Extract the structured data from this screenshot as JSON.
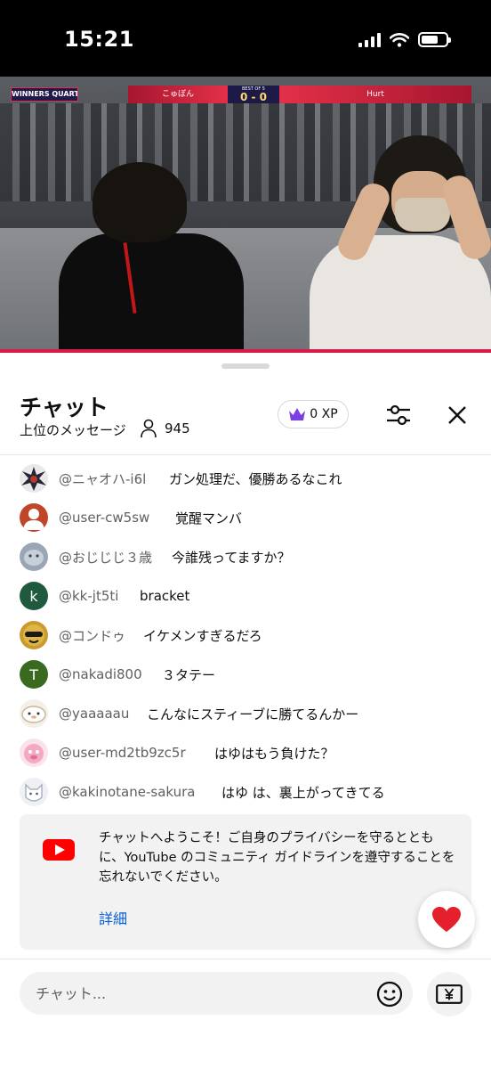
{
  "status_bar": {
    "time": "15:21"
  },
  "video": {
    "round_label": "WINNERS QUARTERS",
    "player_left": "こゅぼん",
    "best_of": "BEST OF 5",
    "score": "0 - 0",
    "player_right": "Hurt"
  },
  "chat_header": {
    "title": "チャット",
    "subtitle": "上位のメッセージ",
    "viewer_count": "945",
    "xp_label": "0 XP"
  },
  "messages": [
    {
      "author": "@ニャオハ-i6l",
      "text": "ガン処理だ、優勝あるなこれ",
      "avatar_letter": "",
      "avatar_color": "#e9e9e9"
    },
    {
      "author": "@user-cw5sw",
      "text": "覚醒マンバ",
      "avatar_letter": "",
      "avatar_color": "#c0462a"
    },
    {
      "author": "@おじじじ３歳",
      "text": "今誰残ってますか？",
      "avatar_letter": "",
      "avatar_color": "#9aa6b4"
    },
    {
      "author": "@kk-jt5ti",
      "text": "bracket",
      "avatar_letter": "k",
      "avatar_color": "#1f5a3f"
    },
    {
      "author": "@コンドゥ",
      "text": "イケメンすぎるだろ",
      "avatar_letter": "",
      "avatar_color": "#c99a2e"
    },
    {
      "author": "@nakadi800",
      "text": "３タテー",
      "avatar_letter": "T",
      "avatar_color": "#3a6a1f"
    },
    {
      "author": "@yaaaaau",
      "text": "こんなにスティーブに勝てるんかー",
      "avatar_letter": "",
      "avatar_color": "#f3f0ea"
    },
    {
      "author": "@user-md2tb9zc5r",
      "text": "はゆはもう負けた？",
      "avatar_letter": "",
      "avatar_color": "#f5b6cc"
    },
    {
      "author": "@kakinotane-sakura",
      "text": "はゆ は、裏上がってきてる",
      "avatar_letter": "",
      "avatar_color": "#eef0f4"
    }
  ],
  "welcome": {
    "text": "チャットへようこそ！ご自身のプライバシーを守るとともに、YouTube のコミュニティ ガイドラインを遵守することを忘れないでください。",
    "link": "詳細"
  },
  "input": {
    "placeholder": "チャット..."
  },
  "icons": {
    "xp": "crown-icon",
    "filter": "sliders-icon",
    "close": "close-icon",
    "viewers": "person-icon",
    "react": "heart-icon",
    "emoji": "smiley-icon",
    "superchat": "yen-note-icon"
  },
  "colors": {
    "accent_red": "#ff0000",
    "link_blue": "#065fd4",
    "xp_purple": "#7b3fe4",
    "heart_red": "#e3202b"
  }
}
